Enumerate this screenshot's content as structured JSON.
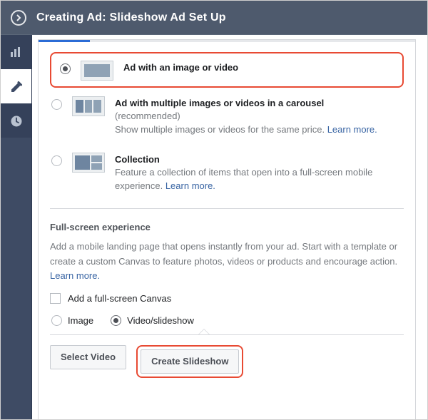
{
  "header": {
    "title": "Creating Ad: Slideshow Ad Set Up"
  },
  "sidebar": {
    "items": [
      {
        "id": "campaign",
        "icon": "bar-chart-icon",
        "active": false
      },
      {
        "id": "adset",
        "icon": "pencil-icon",
        "active": true
      },
      {
        "id": "delivery",
        "icon": "clock-icon",
        "active": false
      }
    ]
  },
  "format_options": [
    {
      "id": "single",
      "selected": true,
      "title": "Ad with an image or video",
      "subtitle": "",
      "highlighted": true
    },
    {
      "id": "carousel",
      "selected": false,
      "title": "Ad with multiple images or videos in a carousel",
      "subtitle_prefix": "(recommended)",
      "subtitle": "Show multiple images or videos for the same price. ",
      "learn_more": "Learn more."
    },
    {
      "id": "collection",
      "selected": false,
      "title": "Collection",
      "subtitle": "Feature a collection of items that open into a full-screen mobile experience. ",
      "learn_more": "Learn more."
    }
  ],
  "full_screen": {
    "heading": "Full-screen experience",
    "description": "Add a mobile landing page that opens instantly from your ad. Start with a template or create a custom Canvas to feature photos, videos or products and encourage action. ",
    "learn_more": "Learn more.",
    "checkbox_label": "Add a full-screen Canvas",
    "checked": false
  },
  "media_type": {
    "options": [
      {
        "id": "image",
        "label": "Image",
        "selected": false
      },
      {
        "id": "video",
        "label": "Video/slideshow",
        "selected": true
      }
    ]
  },
  "actions": {
    "select_video": "Select Video",
    "create_slideshow": "Create Slideshow",
    "highlighted": "create_slideshow"
  }
}
